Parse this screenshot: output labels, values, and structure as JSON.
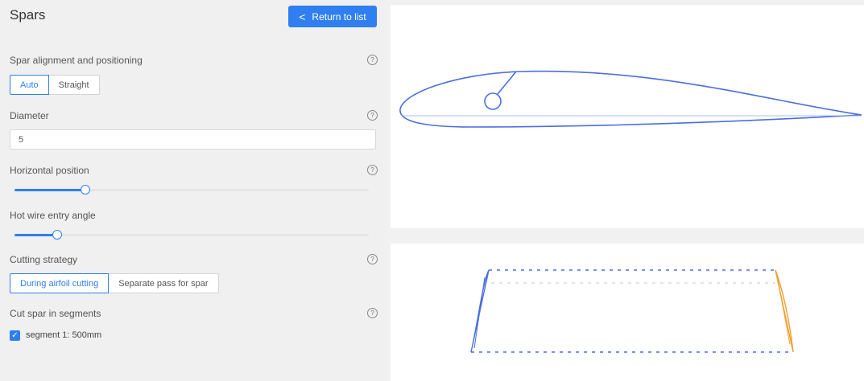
{
  "header": {
    "title": "Spars",
    "return_label": "Return to list"
  },
  "alignment": {
    "label": "Spar alignment and positioning",
    "options": [
      "Auto",
      "Straight"
    ],
    "selected": "Auto"
  },
  "diameter": {
    "label": "Diameter",
    "value": "5"
  },
  "horizontal_position": {
    "label": "Horizontal position",
    "level_percent": 20
  },
  "entry_angle": {
    "label": "Hot wire entry angle",
    "level_percent": 12
  },
  "cutting_strategy": {
    "label": "Cutting strategy",
    "options": [
      "During airfoil cutting",
      "Separate pass for spar"
    ],
    "selected": "During airfoil cutting"
  },
  "segments": {
    "label": "Cut spar in segments",
    "items": [
      {
        "label": "segment 1: 500mm",
        "checked": true
      }
    ]
  },
  "help_glyph": "?",
  "check_glyph": "✓",
  "chevron_glyph": "<",
  "colors": {
    "accent": "#2f7ff0",
    "profile_blue": "#4a6ee0",
    "profile_orange": "#f0a030"
  }
}
